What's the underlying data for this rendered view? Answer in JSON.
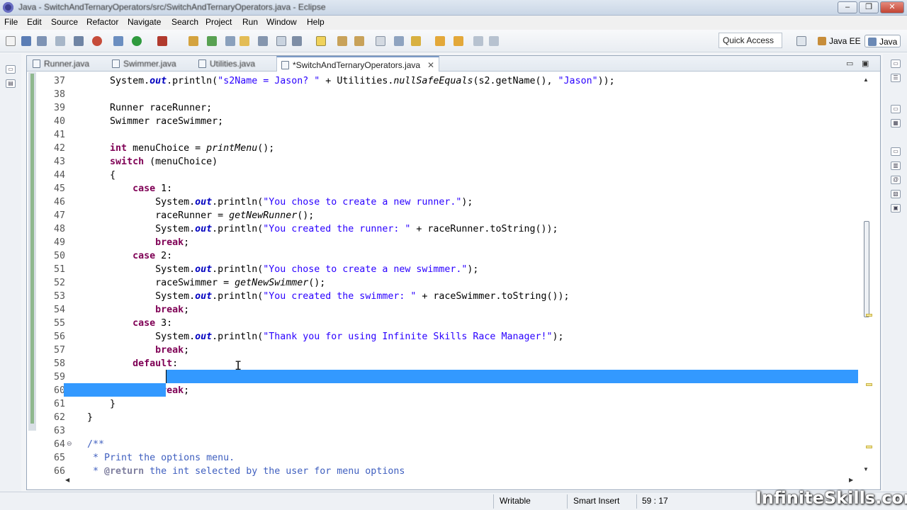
{
  "window": {
    "title": "Java - SwitchAndTernaryOperators/src/SwitchAndTernaryOperators.java - Eclipse",
    "minimize": "–",
    "maximize": "❐",
    "close": "✕"
  },
  "menu": [
    "File",
    "Edit",
    "Source",
    "Refactor",
    "Navigate",
    "Search",
    "Project",
    "Run",
    "Window",
    "Help"
  ],
  "toolbar": {
    "quick_access": "Quick Access",
    "perspective_1": "Java EE",
    "perspective_2": "Java"
  },
  "tabs": [
    {
      "label": "Runner.java"
    },
    {
      "label": "Swimmer.java"
    },
    {
      "label": "Utilities.java"
    },
    {
      "label": "*SwitchAndTernaryOperators.java"
    }
  ],
  "tab_close_glyph": "✕",
  "editor_ctrl": {
    "min": "▭",
    "max": "▣"
  },
  "line_numbers": [
    "37",
    "38",
    "39",
    "40",
    "41",
    "42",
    "43",
    "44",
    "45",
    "46",
    "47",
    "48",
    "49",
    "50",
    "51",
    "52",
    "53",
    "54",
    "55",
    "56",
    "57",
    "58",
    "59",
    "60",
    "61",
    "62",
    "63",
    "64",
    "65",
    "66"
  ],
  "code": {
    "l37a": "        System.",
    "l37b": "out",
    "l37c": ".println(",
    "l37d": "\"s2Name = Jason? \"",
    "l37e": " + Utilities.",
    "l37f": "nullSafeEquals",
    "l37g": "(s2.getName(), ",
    "l37h": "\"Jason\"",
    "l37i": "));",
    "l39": "        Runner raceRunner;",
    "l40": "        Swimmer raceSwimmer;",
    "l42a": "        ",
    "l42b": "int",
    "l42c": " menuChoice = ",
    "l42d": "printMenu",
    "l42e": "();",
    "l43a": "        ",
    "l43b": "switch",
    "l43c": " (menuChoice)",
    "l44": "        {",
    "l45a": "            ",
    "l45b": "case",
    "l45c": " 1:",
    "l46a": "                System.",
    "l46b": "out",
    "l46c": ".println(",
    "l46d": "\"You chose to create a new runner.\"",
    "l46e": ");",
    "l47a": "                raceRunner = ",
    "l47b": "getNewRunner",
    "l47c": "();",
    "l48a": "                System.",
    "l48b": "out",
    "l48c": ".println(",
    "l48d": "\"You created the runner: \"",
    "l48e": " + raceRunner.toString());",
    "l49a": "                ",
    "l49b": "break",
    "l49c": ";",
    "l50a": "            ",
    "l50b": "case",
    "l50c": " 2:",
    "l51a": "                System.",
    "l51b": "out",
    "l51c": ".println(",
    "l51d": "\"You chose to create a new swimmer.\"",
    "l51e": ");",
    "l52a": "                raceSwimmer = ",
    "l52b": "getNewSwimmer",
    "l52c": "();",
    "l53a": "                System.",
    "l53b": "out",
    "l53c": ".println(",
    "l53d": "\"You created the swimmer: \"",
    "l53e": " + raceSwimmer.toString());",
    "l54a": "                ",
    "l54b": "break",
    "l54c": ";",
    "l55a": "            ",
    "l55b": "case",
    "l55c": " 3:",
    "l56a": "                System.",
    "l56b": "out",
    "l56c": ".println(",
    "l56d": "\"Thank you for using Infinite Skills Race Manager!\"",
    "l56e": ");",
    "l57a": "                ",
    "l57b": "break",
    "l57c": ";",
    "l58a": "            ",
    "l58b": "default",
    "l58c": ":",
    "l60a": "                ",
    "l60b": "break",
    "l60c": ";",
    "l61": "        }",
    "l62": "    }",
    "l64": "    /**",
    "l65": "     * Print the options menu.",
    "l66a": "     * ",
    "l66b": "@return",
    "l66c": " the int selected by the user for menu options"
  },
  "status": {
    "writable": "Writable",
    "insert_mode": "Smart Insert",
    "position": "59 : 17"
  },
  "watermark": "InfiniteSkills.com",
  "colors": {
    "keyword": "#7f0055",
    "string": "#2a00ff",
    "field": "#0000c0",
    "comment": "#3f5fbf",
    "selection": "#3399ff"
  }
}
